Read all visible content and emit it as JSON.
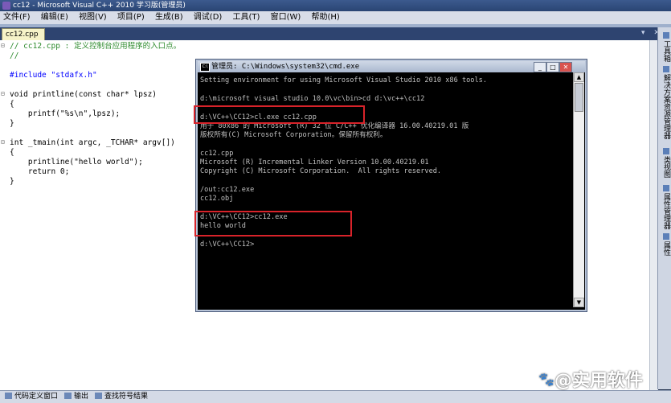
{
  "window": {
    "title": "cc12 - Microsoft Visual C++ 2010 学习版(管理员)"
  },
  "menu": [
    "文件(F)",
    "编辑(E)",
    "视图(V)",
    "项目(P)",
    "生成(B)",
    "调试(D)",
    "工具(T)",
    "窗口(W)",
    "帮助(H)"
  ],
  "editor": {
    "tab_label": "cc12.cpp",
    "tab_controls": "▾ ✕",
    "lines": [
      "// cc12.cpp : 定义控制台应用程序的入口点。",
      "//",
      "",
      "#include \"stdafx.h\"",
      "",
      "void printline(const char* lpsz)",
      "{",
      "    printf(\"%s\\n\",lpsz);",
      "}",
      "",
      "int _tmain(int argc, _TCHAR* argv[])",
      "{",
      "    printline(\"hello world\");",
      "    return 0;",
      "}"
    ]
  },
  "side_panel": [
    "工具箱",
    "解决方案资源管理器",
    "类视图",
    "属性管理器",
    "属性"
  ],
  "cmd": {
    "title": "管理员: C:\\Windows\\system32\\cmd.exe",
    "buttons": {
      "minimize": "_",
      "maximize": "□",
      "close": "✕"
    },
    "lines": [
      "Setting environment for using Microsoft Visual Studio 2010 x86 tools.",
      "",
      "d:\\microsoft visual studio 10.0\\vc\\bin>cd d:\\vc++\\cc12",
      "",
      "d:\\VC++\\CC12>cl.exe cc12.cpp",
      "用于 80x86 的 Microsoft (R) 32 位 C/C++ 优化编译器 16.00.40219.01 版",
      "版权所有(C) Microsoft Corporation。保留所有权利。",
      "",
      "cc12.cpp",
      "Microsoft (R) Incremental Linker Version 10.00.40219.01",
      "Copyright (C) Microsoft Corporation.  All rights reserved.",
      "",
      "/out:cc12.exe",
      "cc12.obj",
      "",
      "d:\\VC++\\CC12>cc12.exe",
      "hello world",
      "",
      "d:\\VC++\\CC12>"
    ],
    "scroll_up": "▲",
    "scroll_down": "▼"
  },
  "status_bar": [
    "代码定义窗口",
    "输出",
    "查找符号结果"
  ],
  "watermark": {
    "icon": "paw-icon",
    "text": "@实用软件"
  },
  "colors": {
    "comment": "#2c8a2c",
    "keyword": "#0000ff",
    "string": "#a31515",
    "highlight": "#d8232a"
  }
}
